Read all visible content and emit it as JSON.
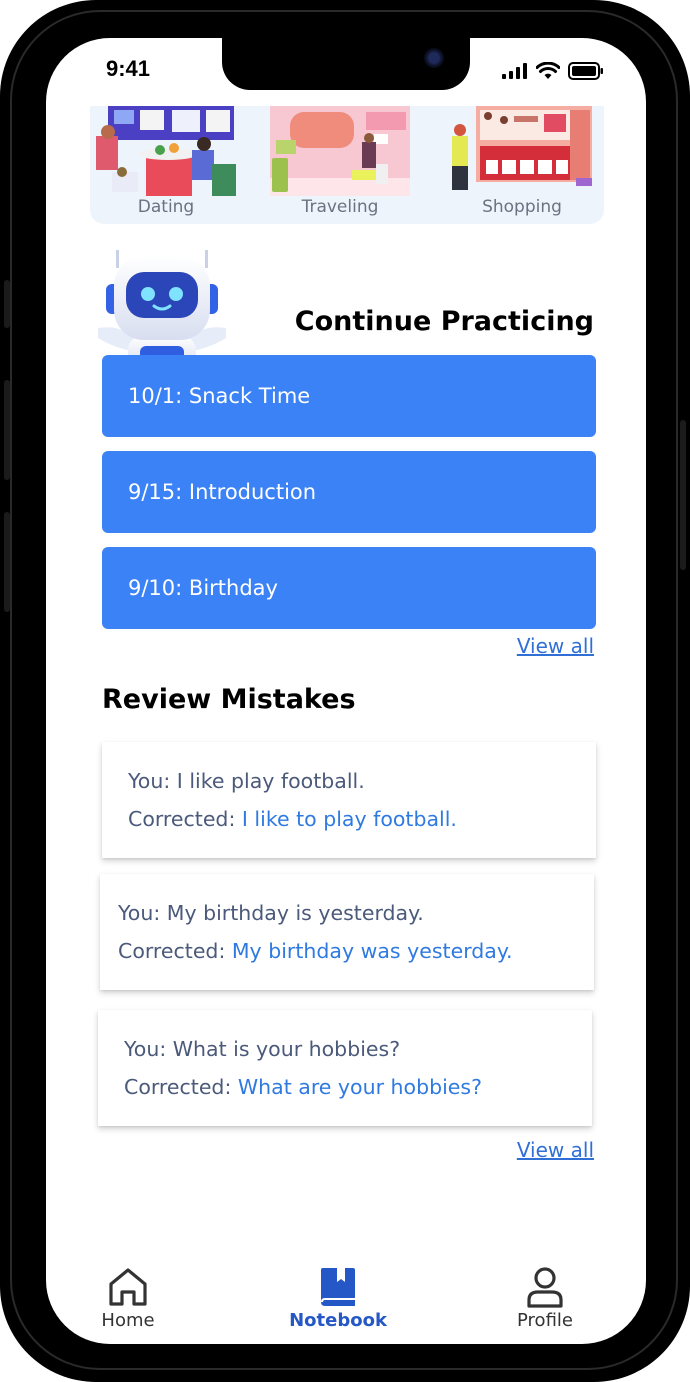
{
  "status": {
    "time": "9:41"
  },
  "topics": [
    {
      "label": "Dating"
    },
    {
      "label": "Traveling"
    },
    {
      "label": "Shopping"
    }
  ],
  "continue_practicing": {
    "title": "Continue Practicing",
    "items": [
      {
        "label": "10/1: Snack Time"
      },
      {
        "label": "9/15: Introduction"
      },
      {
        "label": "9/10: Birthday"
      }
    ],
    "view_all": "View all"
  },
  "review_mistakes": {
    "title": "Review Mistakes",
    "cards": [
      {
        "you": "You: I like play football.",
        "corrected_label": "Corrected: ",
        "corrected": "I like to play football."
      },
      {
        "you": "You: My birthday is yesterday.",
        "corrected_label": "Corrected: ",
        "corrected": "My birthday was yesterday."
      },
      {
        "you": "You: What is your hobbies?",
        "corrected_label": "Corrected: ",
        "corrected": "What are your hobbies?"
      }
    ],
    "view_all": "View all"
  },
  "tabbar": {
    "home": "Home",
    "notebook": "Notebook",
    "profile": "Profile",
    "active": "notebook"
  },
  "colors": {
    "accent": "#3b82f6",
    "link": "#2f6fd6",
    "active_tab": "#2558c6",
    "corrected_text": "#2f7ae0"
  }
}
